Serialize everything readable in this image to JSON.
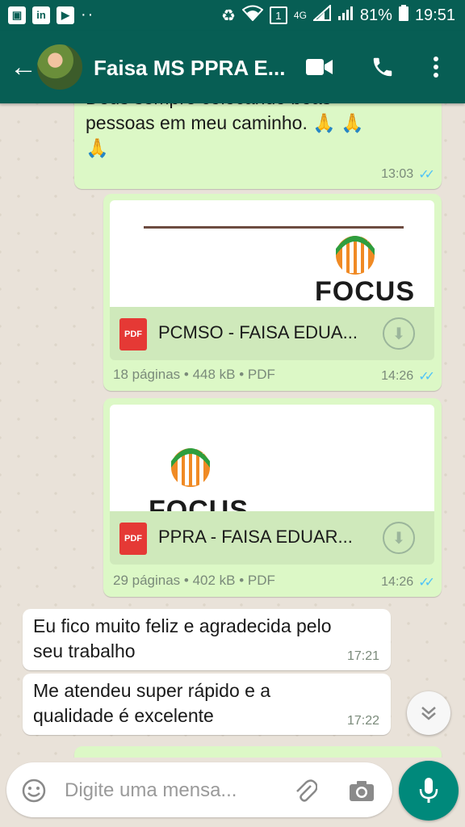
{
  "status_bar": {
    "icons": [
      "image-icon",
      "linkedin-icon",
      "youtube-icon",
      "more-notifications-icon",
      "recycle-icon",
      "wifi-icon",
      "sim-icon",
      "signal-icon"
    ],
    "sim_slot": "1",
    "network": "4G",
    "battery": "81%",
    "time": "19:51"
  },
  "header": {
    "title": "Faisa MS PPRA E...",
    "icons": [
      "back-arrow-icon",
      "video-call-icon",
      "phone-icon",
      "more-options-icon"
    ]
  },
  "messages": [
    {
      "kind": "text",
      "direction": "out",
      "text_line1": "Deus sempre colocando boas",
      "text_line2": "pessoas em meu caminho. 🙏 🙏",
      "text_line3": "🙏",
      "time": "13:03"
    },
    {
      "kind": "document",
      "direction": "out",
      "preview_text": "FOCUS",
      "icon_label": "PDF",
      "name": "PCMSO - FAISA EDUA...",
      "info": "18 páginas • 448 kB • PDF",
      "time": "14:26"
    },
    {
      "kind": "document",
      "direction": "out",
      "preview_text": "FOCUS",
      "icon_label": "PDF",
      "name": "PPRA - FAISA EDUAR...",
      "info": "29 páginas • 402 kB • PDF",
      "time": "14:26"
    },
    {
      "kind": "text",
      "direction": "in",
      "text_line1": "Eu fico muito feliz e agradecida pelo",
      "text_line2": "seu trabalho",
      "time": "17:21"
    },
    {
      "kind": "text",
      "direction": "in",
      "text_line1": "Me atendeu super rápido e a",
      "text_line2": "qualidade é excelente",
      "time": "17:22"
    }
  ],
  "composer": {
    "placeholder": "Digite uma mensa...",
    "icons": [
      "emoji-icon",
      "attach-icon",
      "camera-icon",
      "microphone-icon"
    ]
  },
  "colors": {
    "header": "#075e54",
    "outgoing": "#dcf8c6",
    "incoming": "#ffffff",
    "read_ticks": "#4fc3f7",
    "mic_button": "#00897b"
  }
}
